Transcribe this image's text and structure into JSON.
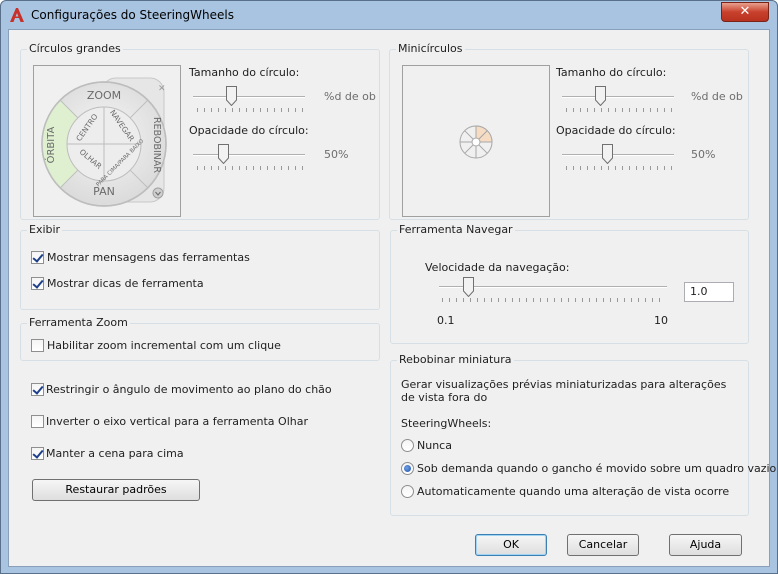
{
  "window": {
    "title": "Configurações do SteeringWheels",
    "close_symbol": "✕"
  },
  "big_wheels": {
    "group_title": "Círculos grandes",
    "size_label": "Tamanho do círculo:",
    "size_value": "%d de ob",
    "size_level": 0.33,
    "opacity_label": "Opacidade do círculo:",
    "opacity_value": "50%",
    "opacity_level": 0.25,
    "wheel": {
      "zoom": "ZOOM",
      "rewind": "REBOBINAR",
      "pan": "PAN",
      "orbit": "ÓRBITA",
      "center": "CENTRO",
      "walk": "NAVEGAR",
      "look": "OLHAR",
      "up_down": "PARA CIMA/PARA BAIXO"
    }
  },
  "mini_wheels": {
    "group_title": "Minicírculos",
    "size_label": "Tamanho do círculo:",
    "size_value": "%d de ob",
    "size_level": 0.33,
    "opacity_label": "Opacidade do círculo:",
    "opacity_value": "50%",
    "opacity_level": 0.4
  },
  "display": {
    "group_title": "Exibir",
    "show_messages": {
      "label": "Mostrar mensagens das ferramentas",
      "checked": true
    },
    "show_tips": {
      "label": "Mostrar dicas de ferramenta",
      "checked": true
    }
  },
  "zoom_tool": {
    "group_title": "Ferramenta Zoom",
    "incremental": {
      "label": "Habilitar zoom incremental com um clique",
      "checked": false
    }
  },
  "options": {
    "restrict_angle": {
      "label": "Restringir o ângulo de movimento ao plano do chão",
      "checked": true
    },
    "invert_axis": {
      "label": "Inverter o eixo vertical para a ferramenta Olhar",
      "checked": false
    },
    "keep_up": {
      "label": "Manter a cena para cima",
      "checked": true
    }
  },
  "restore_button": "Restaurar padrões",
  "walk_tool": {
    "group_title": "Ferramenta Navegar",
    "speed_label": "Velocidade da navegação:",
    "speed_value": "1.0",
    "min_label": "0.1",
    "max_label": "10",
    "speed_level": 0.11
  },
  "rewind": {
    "group_title": "Rebobinar miniatura",
    "description": "Gerar visualizações prévias miniaturizadas para alterações de vista fora do",
    "steering_label": "SteeringWheels:",
    "options": [
      {
        "label": "Nunca",
        "selected": false
      },
      {
        "label": "Sob demanda quando o gancho é movido sobre um quadro vazio",
        "selected": true
      },
      {
        "label": "Automaticamente quando uma alteração de vista ocorre",
        "selected": false
      }
    ]
  },
  "footer": {
    "ok": "OK",
    "cancel": "Cancelar",
    "help": "Ajuda"
  },
  "colors": {
    "accent": "#c8412d",
    "title_bar": "#a9c4e0",
    "dialog_bg": "#f0f0f0",
    "orbit_highlight": "#dff0d0"
  }
}
